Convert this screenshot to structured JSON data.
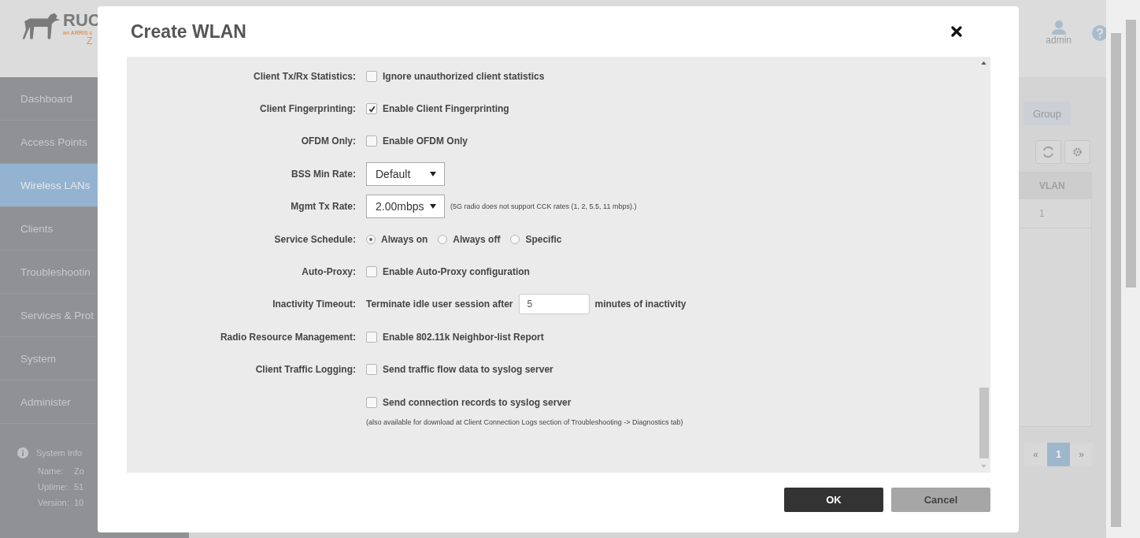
{
  "background": {
    "logo": {
      "name": "RUC",
      "tagline": "an ARRIS c",
      "product": "Z"
    },
    "user": "admin",
    "sidebar": {
      "items": [
        {
          "label": "Dashboard",
          "selected": false
        },
        {
          "label": "Access Points",
          "selected": false
        },
        {
          "label": "Wireless LANs",
          "selected": true
        },
        {
          "label": "Clients",
          "selected": false
        },
        {
          "label": "Troubleshootin",
          "selected": false
        },
        {
          "label": "Services & Prot",
          "selected": false
        },
        {
          "label": "System",
          "selected": false
        },
        {
          "label": "Administer",
          "selected": false
        }
      ]
    },
    "system_info": {
      "title": "System Info",
      "rows": [
        {
          "label": "Name:",
          "value": "Zo"
        },
        {
          "label": "Uptime:",
          "value": "51"
        },
        {
          "label": "Version:",
          "value": "10"
        }
      ]
    },
    "toggle": {
      "label": "Group"
    },
    "table": {
      "columns": [
        "VLAN"
      ],
      "rows": [
        [
          "1"
        ]
      ]
    },
    "pagination": {
      "prev": "«",
      "pages": [
        {
          "label": "1",
          "selected": true
        }
      ],
      "next": "»"
    }
  },
  "dialog": {
    "title": "Create WLAN",
    "fields": [
      {
        "kind": "checkbox",
        "label": "Client Tx/Rx Statistics:",
        "option": "Ignore unauthorized client statistics",
        "checked": false
      },
      {
        "kind": "checkbox",
        "label": "Client Fingerprinting:",
        "option": "Enable Client Fingerprinting",
        "checked": true
      },
      {
        "kind": "checkbox",
        "label": "OFDM Only:",
        "option": "Enable OFDM Only",
        "checked": false
      },
      {
        "kind": "select",
        "label": "BSS Min Rate:",
        "value": "Default"
      },
      {
        "kind": "select",
        "label": "Mgmt Tx Rate:",
        "value": "2.00mbps",
        "note": "(5G radio does not support CCK rates (1, 2, 5.5, 11 mbps).)"
      },
      {
        "kind": "radio",
        "label": "Service Schedule:",
        "options": [
          {
            "label": "Always on",
            "selected": true
          },
          {
            "label": "Always off",
            "selected": false
          },
          {
            "label": "Specific",
            "selected": false
          }
        ]
      },
      {
        "kind": "checkbox",
        "label": "Auto-Proxy:",
        "option": "Enable Auto-Proxy configuration",
        "checked": false
      },
      {
        "kind": "input",
        "label": "Inactivity Timeout:",
        "before": "Terminate idle user session after",
        "value": "5",
        "after": "minutes of inactivity"
      },
      {
        "kind": "checkbox",
        "label": "Radio Resource Management:",
        "option": "Enable 802.11k Neighbor-list Report",
        "checked": false
      },
      {
        "kind": "checkbox",
        "label": "Client Traffic Logging:",
        "option": "Send traffic flow data to syslog server",
        "checked": false
      },
      {
        "kind": "checkbox",
        "option": "Send connection records to syslog server",
        "checked": false,
        "note": "(also available for download at Client Connection Logs section of Troubleshooting -> Diagnostics tab)"
      }
    ],
    "buttons": [
      {
        "kind": "primary",
        "label": "OK"
      },
      {
        "kind": "secondary",
        "label": "Cancel"
      }
    ]
  }
}
